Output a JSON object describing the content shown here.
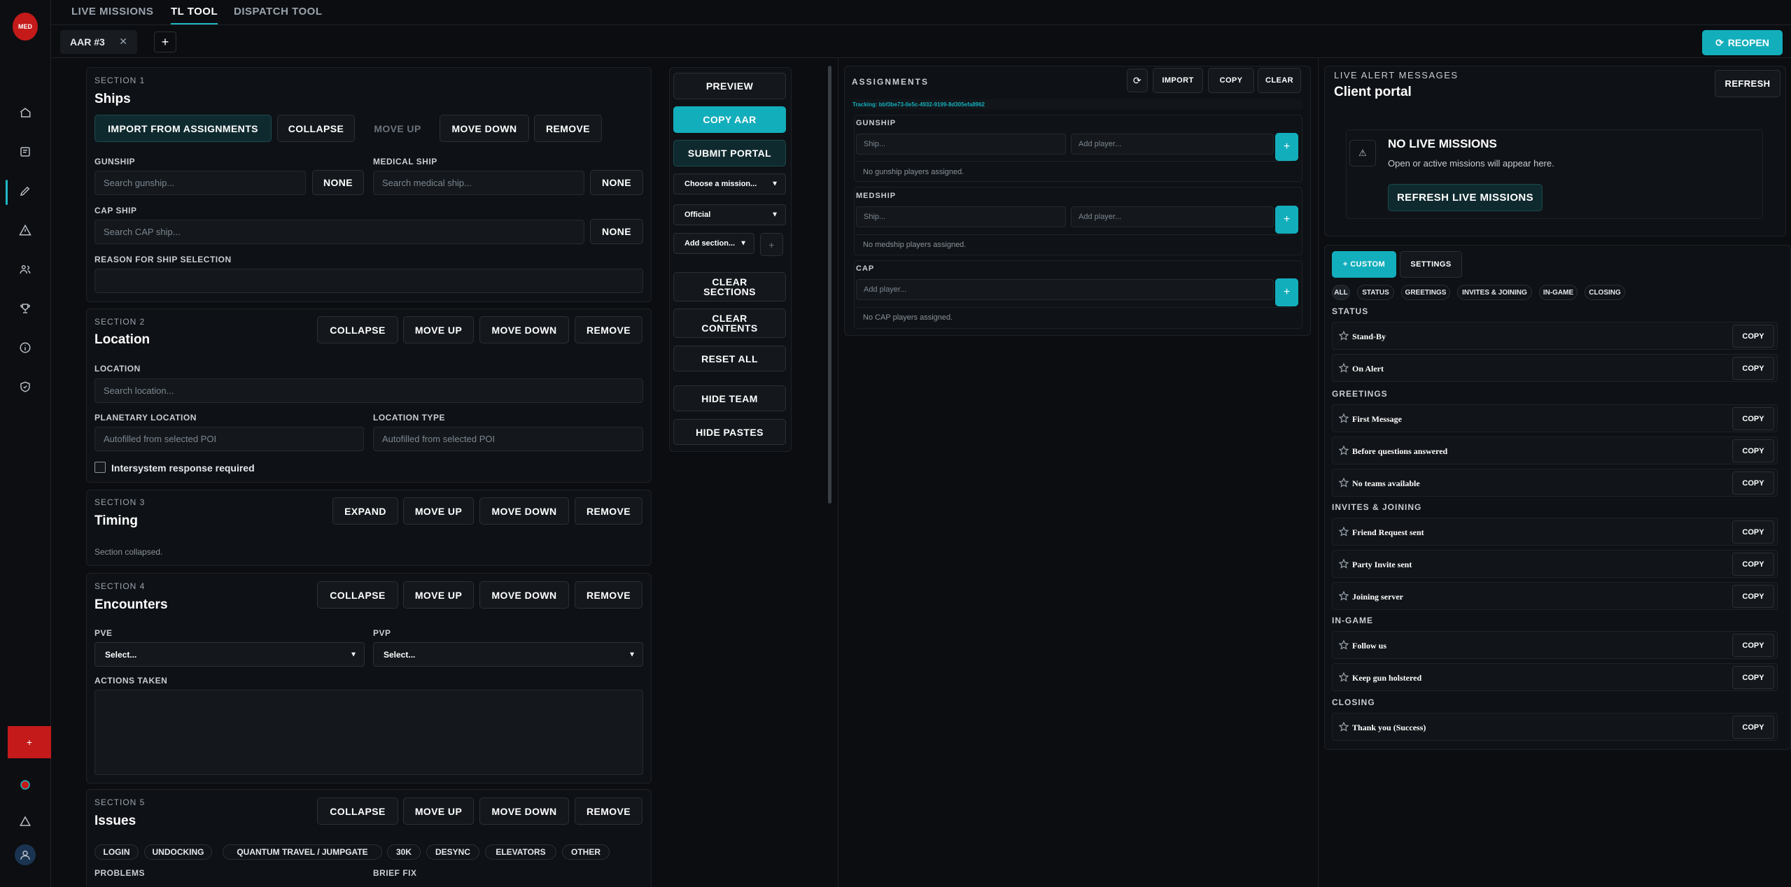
{
  "app": {
    "logo_text": "MED"
  },
  "nav": {
    "tabs": [
      "LIVE MISSIONS",
      "TL TOOL",
      "DISPATCH TOOL"
    ],
    "active": "TL TOOL"
  },
  "doc": {
    "tab_label": "AAR #3",
    "close": "✕",
    "add": "+",
    "reopen": "REOPEN"
  },
  "sidebar": {
    "add": "+"
  },
  "sections": {
    "s1": {
      "num": "SECTION 1",
      "title": "Ships",
      "import": "IMPORT FROM ASSIGNMENTS",
      "collapse": "COLLAPSE",
      "up": "MOVE UP",
      "down": "MOVE DOWN",
      "remove": "REMOVE",
      "gunship_label": "GUNSHIP",
      "gunship_ph": "Search gunship...",
      "medical_label": "MEDICAL SHIP",
      "medical_ph": "Search medical ship...",
      "none": "NONE",
      "cap_label": "CAP SHIP",
      "cap_ph": "Search CAP ship...",
      "reason_label": "REASON FOR SHIP SELECTION",
      "reason_value": ""
    },
    "s2": {
      "num": "SECTION 2",
      "title": "Location",
      "collapse": "COLLAPSE",
      "up": "MOVE UP",
      "down": "MOVE DOWN",
      "remove": "REMOVE",
      "loc_label": "LOCATION",
      "loc_ph": "Search location...",
      "planetary_label": "PLANETARY LOCATION",
      "planetary_ph": "Autofilled from selected POI",
      "type_label": "LOCATION TYPE",
      "type_ph": "Autofilled from selected POI",
      "intersystem": "Intersystem response required"
    },
    "s3": {
      "num": "SECTION 3",
      "title": "Timing",
      "expand": "EXPAND",
      "up": "MOVE UP",
      "down": "MOVE DOWN",
      "remove": "REMOVE",
      "collapsed": "Section collapsed."
    },
    "s4": {
      "num": "SECTION 4",
      "title": "Encounters",
      "collapse": "COLLAPSE",
      "up": "MOVE UP",
      "down": "MOVE DOWN",
      "remove": "REMOVE",
      "pve_label": "PVE",
      "pvp_label": "PVP",
      "select": "Select...",
      "actions_label": "ACTIONS TAKEN"
    },
    "s5": {
      "num": "SECTION 5",
      "title": "Issues",
      "collapse": "COLLAPSE",
      "up": "MOVE UP",
      "down": "MOVE DOWN",
      "remove": "REMOVE",
      "chips": [
        "LOGIN",
        "UNDOCKING",
        "QUANTUM TRAVEL / JUMPGATE",
        "30K",
        "DESYNC",
        "ELEVATORS",
        "OTHER"
      ],
      "problems_label": "PROBLEMS",
      "brief_label": "BRIEF FIX"
    }
  },
  "controls": {
    "preview": "PREVIEW",
    "copy_aar": "COPY AAR",
    "submit": "SUBMIT PORTAL",
    "mission": "Choose a mission...",
    "official": "Official",
    "add_section": "Add section...",
    "add_plus": "+",
    "clear_sections": "CLEAR SECTIONS",
    "clear_contents": "CLEAR CONTENTS",
    "reset": "RESET ALL",
    "hide_team": "HIDE TEAM",
    "hide_pastes": "HIDE PASTES"
  },
  "assignments": {
    "title": "ASSIGNMENTS",
    "import": "IMPORT",
    "copy": "COPY",
    "clear": "CLEAR",
    "tracking": "Tracking: bbf3be73-0e5c-4932-9199-8d305efa8962",
    "gunship": {
      "label": "GUNSHIP",
      "ship_ph": "Ship...",
      "player_ph": "Add player...",
      "empty": "No gunship players assigned."
    },
    "medship": {
      "label": "MEDSHIP",
      "ship_ph": "Ship...",
      "player_ph": "Add player...",
      "empty": "No medship players assigned."
    },
    "cap": {
      "label": "CAP",
      "player_ph": "Add player...",
      "empty": "No CAP players assigned."
    },
    "plus": "+"
  },
  "alerts": {
    "label": "LIVE ALERT MESSAGES",
    "title": "Client portal",
    "refresh": "REFRESH",
    "none_title": "NO LIVE MISSIONS",
    "none_sub": "Open or active missions will appear here.",
    "refresh_live": "REFRESH LIVE MISSIONS"
  },
  "messages": {
    "custom": "+ CUSTOM",
    "settings": "SETTINGS",
    "filters": [
      "ALL",
      "STATUS",
      "GREETINGS",
      "INVITES & JOINING",
      "IN-GAME",
      "CLOSING"
    ],
    "copy": "COPY",
    "categories": [
      {
        "name": "STATUS",
        "items": [
          "Stand-By",
          "On Alert"
        ]
      },
      {
        "name": "GREETINGS",
        "items": [
          "First Message",
          "Before questions answered",
          "No teams available"
        ]
      },
      {
        "name": "INVITES & JOINING",
        "items": [
          "Friend Request sent",
          "Party Invite sent",
          "Joining server"
        ]
      },
      {
        "name": "IN-GAME",
        "items": [
          "Follow us",
          "Keep gun holstered"
        ]
      },
      {
        "name": "CLOSING",
        "items": [
          "Thank you (Success)"
        ]
      }
    ]
  },
  "colors": {
    "accent": "#13aebc",
    "danger": "#c41a1a",
    "bg": "#0b0d10"
  }
}
